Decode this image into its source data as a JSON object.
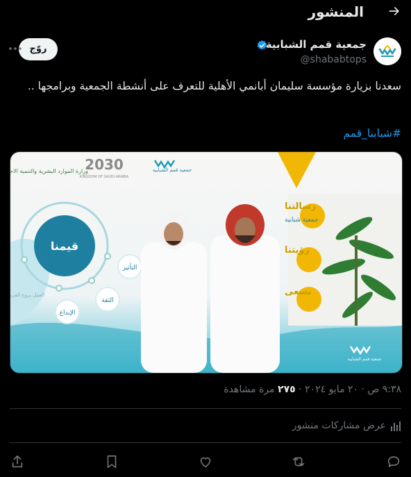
{
  "header": {
    "title": "المنشور"
  },
  "author": {
    "name": "جمعية قمم الشبابية",
    "handle": "@shababtops",
    "verified": true
  },
  "follow_label": "روّج",
  "tweet": {
    "text": "سعدنا بزيارة مؤسسة سليمان أبانمي الأهلية للتعرف على أنشطة الجمعية وبرامجها ..",
    "hashtag": "#شبابنا_قمم"
  },
  "media": {
    "vision_year": "2030",
    "kingdom_text": "KINGDOM OF SAUDI ARABIA",
    "ministry_text": "وزارة الموارد البشرية والتنمية الاجتماعية",
    "org_name": "جمعية قمم الشبابية",
    "values_title": "قيمنا",
    "values": [
      "التأثير",
      "الثقة",
      "الإبداع",
      "العمل بروح الفريق"
    ],
    "panel_headings": [
      "رسالتنا",
      "رؤيتنا",
      "نسعى"
    ],
    "panel_mission_text": "جمعية شبابية",
    "bottom_logo_text": "جمعية قمم الشبابية"
  },
  "meta": {
    "time": "٩:٣٨ ص",
    "date": "٢٠ مايو ٢٠٢٤",
    "views_count": "٢٧٥",
    "views_label": "مرة مشاهدة"
  },
  "engagements_label": "عرض مشاركات منشور",
  "colors": {
    "accent": "#1d9bf0",
    "text": "#e7e9ea",
    "muted": "#71767b",
    "border": "#2f3336",
    "teal": "#1e9bb5",
    "gold": "#f2b705"
  }
}
